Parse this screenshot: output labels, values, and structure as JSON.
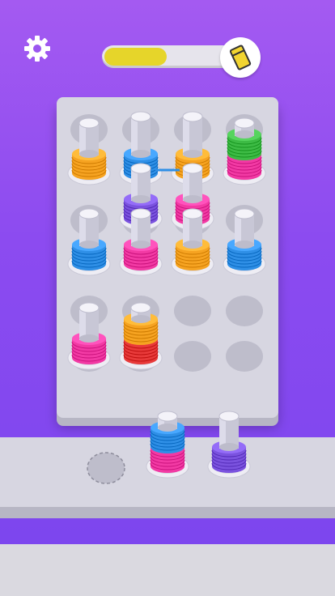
{
  "header": {
    "settings_icon": "gear-icon",
    "progress": {
      "fraction": 0.45,
      "icon": "yellow-ticket-icon",
      "fill_color": "#e6d52a"
    }
  },
  "colors": {
    "orange": "#f6a321",
    "blue": "#2f8fe6",
    "green": "#3dbb45",
    "pink": "#f23aa4",
    "purple": "#7b53df",
    "red": "#e83a3a",
    "white": "#f5f5f5"
  },
  "board": {
    "columns": 4,
    "rows": [
      [
        {
          "stack": [
            "orange"
          ],
          "selected": false
        },
        {
          "stack": [
            "blue"
          ],
          "selected": true
        },
        {
          "stack": [
            "orange"
          ],
          "selected": true
        },
        {
          "stack": [
            "pink",
            "green"
          ],
          "selected": false
        }
      ],
      [
        {
          "stack": [],
          "selected": false
        },
        {
          "stack": [
            "purple"
          ],
          "selected": false
        },
        {
          "stack": [
            "pink"
          ],
          "selected": false
        },
        {
          "stack": [],
          "selected": false
        }
      ],
      [
        {
          "stack": [
            "blue"
          ],
          "selected": false
        },
        {
          "stack": [
            "pink"
          ],
          "selected": false
        },
        {
          "stack": [
            "orange"
          ],
          "selected": false
        },
        {
          "stack": [
            "blue"
          ],
          "selected": false
        }
      ],
      [
        {
          "stack": [
            "pink"
          ],
          "selected": false
        },
        {
          "stack": [
            "red",
            "orange"
          ],
          "selected": false
        },
        {
          "stack": [],
          "selected": false
        },
        {
          "stack": [],
          "selected": false
        }
      ]
    ]
  },
  "shelf": {
    "slots": [
      {
        "stack": [],
        "locked": true
      },
      {
        "stack": [
          "pink",
          "blue"
        ],
        "locked": false
      },
      {
        "stack": [
          "purple"
        ],
        "locked": false
      }
    ]
  }
}
